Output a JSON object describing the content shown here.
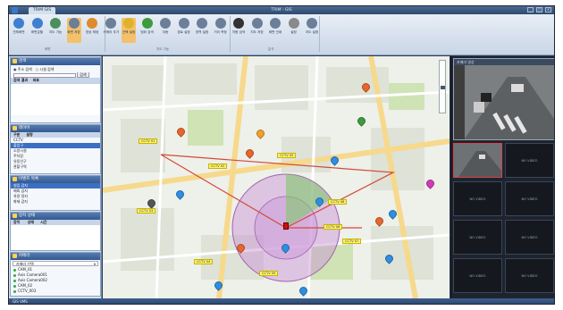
{
  "window": {
    "title": "TRIM - GIS",
    "tab": "TRIM GIS"
  },
  "ribbon": {
    "buttons": [
      {
        "label": "전체화면",
        "icon": "fullscreen-icon"
      },
      {
        "label": "화면분할",
        "icon": "split-icon"
      },
      {
        "label": "지도 기능",
        "icon": "map-icon"
      },
      {
        "label": "화면 저장",
        "icon": "save-icon"
      },
      {
        "label": "영상 재생",
        "icon": "play-icon"
      },
      {
        "label": "카메라 추가",
        "icon": "camera-icon"
      },
      {
        "label": "선택 설정",
        "icon": "select-icon"
      },
      {
        "label": "범위 검색",
        "icon": "radius-icon"
      },
      {
        "label": "이동",
        "icon": "move-icon"
      },
      {
        "label": "경로 설정",
        "icon": "route-icon"
      },
      {
        "label": "영역 설정",
        "icon": "area-icon"
      },
      {
        "label": "거리 측정",
        "icon": "measure-icon"
      },
      {
        "label": "차량 검색",
        "icon": "car-icon"
      },
      {
        "label": "지도 저장",
        "icon": "map-save-icon"
      },
      {
        "label": "화면 인쇄",
        "icon": "print-icon"
      },
      {
        "label": "설정",
        "icon": "settings-icon"
      },
      {
        "label": "지도 설정",
        "icon": "map-settings-icon"
      }
    ],
    "groups": [
      "화면",
      "지도 기능",
      "분석"
    ]
  },
  "left": {
    "search": {
      "title": "검색",
      "opt1": "주소 검색",
      "opt2": "시설 검색",
      "search_btn": "검색",
      "col1": "검색 결과",
      "col2": "좌표"
    },
    "layers": {
      "title": "레이어",
      "col1": "구분",
      "col2": "설명",
      "rows": [
        "CCTV",
        "출입구",
        "소방시설",
        "주차장",
        "유동인구",
        "관할구역"
      ]
    },
    "events": {
      "title": "이벤트 목록",
      "rows": [
        "침입 감지",
        "배회 감지",
        "차량 정지",
        "화재 감지"
      ]
    },
    "devices": {
      "title": "장치 상태",
      "col1": "장치",
      "col2": "상태",
      "col3": "시간"
    },
    "cameras": {
      "title": "카메라",
      "select_label": "카메라 선택",
      "items": [
        "CAM_01",
        "Axis Camera001",
        "Axis Camera002",
        "CAM_02",
        "CCTV_003"
      ]
    }
  },
  "map": {
    "labels": [
      "CCTV 01",
      "CCTV 02",
      "CCTV 03",
      "CCTV 04",
      "CCTV 05",
      "CCTV 06",
      "CCTV 07",
      "CCTV 08",
      "CCTV 09"
    ]
  },
  "right": {
    "main_cam_title": "카메라 영상",
    "thumb_text": "NO VIDEO"
  },
  "status": {
    "text": "GIS VMS"
  },
  "colors": {
    "accent": "#3b6fc2",
    "route": "#d24a3a",
    "label_bg": "#fff36b"
  }
}
